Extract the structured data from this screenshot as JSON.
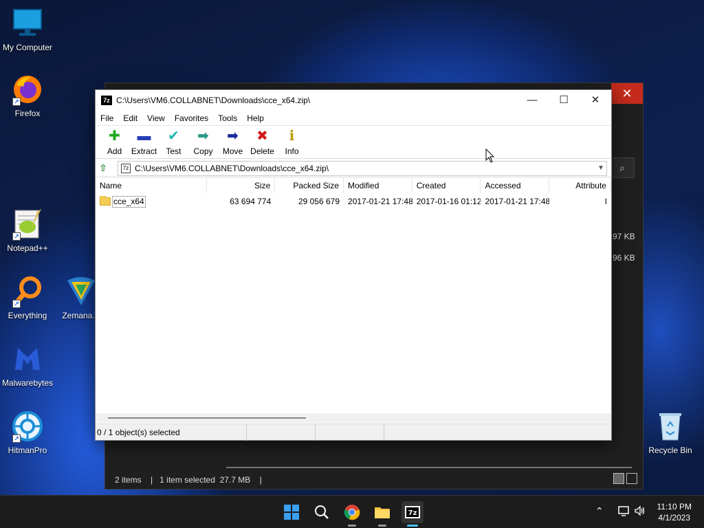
{
  "desktop": {
    "icons": [
      {
        "label": "My Computer"
      },
      {
        "label": "Firefox"
      },
      {
        "label": "Notepad++"
      },
      {
        "label": "Everything"
      },
      {
        "label": "Zemana.A"
      },
      {
        "label": "Malwarebytes"
      },
      {
        "label": "HitmanPro"
      },
      {
        "label": "Recycle Bin"
      }
    ]
  },
  "explorer_bg": {
    "close_glyph": "✕",
    "sizes": [
      "97 KB",
      "96 KB"
    ],
    "status": {
      "items": "2 items",
      "selected": "1 item selected",
      "size": "27.7 MB",
      "sep": "|"
    }
  },
  "zip_window": {
    "title": "C:\\Users\\VM6.COLLABNET\\Downloads\\cce_x64.zip\\",
    "app_icon_text": "7z",
    "controls": {
      "minimize": "—",
      "maximize": "☐",
      "close": "✕"
    },
    "menu": [
      "File",
      "Edit",
      "View",
      "Favorites",
      "Tools",
      "Help"
    ],
    "toolbar": [
      {
        "label": "Add",
        "icon": "add-icon",
        "glyph": "✚",
        "color": "#1eaa1e"
      },
      {
        "label": "Extract",
        "icon": "extract-icon",
        "glyph": "▬",
        "color": "#2a3fb5"
      },
      {
        "label": "Test",
        "icon": "test-icon",
        "glyph": "✔",
        "color": "#1bb4b4"
      },
      {
        "label": "Copy",
        "icon": "copy-icon",
        "glyph": "➡",
        "color": "#2a9a8a"
      },
      {
        "label": "Move",
        "icon": "move-icon",
        "glyph": "➡",
        "color": "#1a2a9a"
      },
      {
        "label": "Delete",
        "icon": "delete-icon",
        "glyph": "✖",
        "color": "#d01a1a"
      },
      {
        "label": "Info",
        "icon": "info-icon",
        "glyph": "ℹ",
        "color": "#b89a00"
      }
    ],
    "address": "C:\\Users\\VM6.COLLABNET\\Downloads\\cce_x64.zip\\",
    "columns": [
      "Name",
      "Size",
      "Packed Size",
      "Modified",
      "Created",
      "Accessed",
      "Attribute"
    ],
    "rows": [
      {
        "name": "cce_x64",
        "size": "63 694 774",
        "packed": "29 056 679",
        "modified": "2017-01-21 17:48",
        "created": "2017-01-16 01:12",
        "accessed": "2017-01-21 17:48",
        "attr": "I"
      }
    ],
    "status": "0 / 1 object(s) selected"
  },
  "taskbar": {
    "apps": [
      "start-icon",
      "search-icon",
      "chrome-icon",
      "file-explorer-icon",
      "7zip-icon"
    ],
    "time": "11:10 PM",
    "date": "4/1/2023"
  }
}
